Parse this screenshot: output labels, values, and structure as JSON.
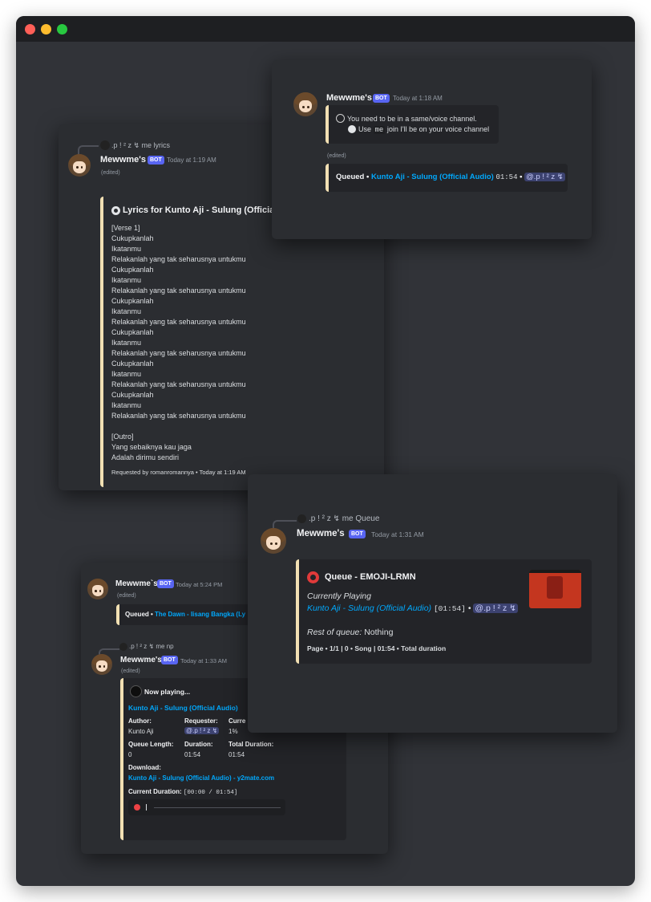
{
  "window": {
    "traffic_colors": [
      "#ff5f57",
      "#febc2e",
      "#28c840"
    ]
  },
  "bot": {
    "name": "Mewwme's",
    "name_plain": "Mewwme`s",
    "badge": "BOT"
  },
  "voice_error": {
    "time": "Today at 1:18 AM",
    "line1": "You need to be in a same/voice channel.",
    "line2_pre": "Use",
    "line2_code": "me",
    "line2_post": "join I'll be on your voice channel",
    "edited": "(edited)",
    "queued_label": "Queued •",
    "queued_track": "Kunto Aji - Sulung (Official Audio)",
    "queued_duration": "01:54",
    "queued_sep": "•",
    "queued_user": "@.p ! ² z ↯"
  },
  "lyrics_msg": {
    "reply_text": ".p ! ² z ↯  me lyrics",
    "time": "Today at 1:19 AM",
    "edited": "(edited)",
    "title": "Lyrics for Kunto Aji - Sulung (Official",
    "lines": [
      "[Verse 1]",
      "Cukupkanlah",
      "Ikatanmu",
      "Relakanlah yang tak seharusnya untukmu",
      "Cukupkanlah",
      "Ikatanmu",
      "Relakanlah yang tak seharusnya untukmu",
      "Cukupkanlah",
      "Ikatanmu",
      "Relakanlah yang tak seharusnya untukmu",
      "Cukupkanlah",
      "Ikatanmu",
      "Relakanlah yang tak seharusnya untukmu",
      "Cukupkanlah",
      "Ikatanmu",
      "Relakanlah yang tak seharusnya untukmu",
      "Cukupkanlah",
      "Ikatanmu",
      "Relakanlah yang tak seharusnya untukmu",
      "",
      "[Outro]",
      "Yang sebaiknya kau jaga",
      "Adalah dirimu sendiri"
    ],
    "footer": "Requested by romanromannya • Today at 1:19 AM"
  },
  "queue_msg": {
    "reply_text": ".p ! ² z ↯  me Queue",
    "time": "Today at 1:31 AM",
    "title": "Queue - EMOJI-LRMN",
    "currently_playing": "Currently Playing",
    "track": "Kunto Aji - Sulung (Official Audio)",
    "duration": "[01:54]",
    "sep": "•",
    "user": "@.p ! ² z ↯",
    "rest_label": "Rest of queue:",
    "rest_value": "Nothing",
    "footer": "Page • 1/1 | 0 • Song | 01:54 • Total duration"
  },
  "dawn_msg": {
    "time": "Today at 5:24 PM",
    "edited": "(edited)",
    "queued_label": "Queued •",
    "queued_track": "The Dawn - Iisang Bangka (Ly"
  },
  "np_msg": {
    "reply_text": ".p ! ² z ↯  me np",
    "time": "Today at 1:33 AM",
    "edited": "(edited)",
    "title": "Now playing...",
    "track": "Kunto Aji - Sulung (Official Audio)",
    "fields": {
      "author_label": "Author:",
      "author_value": "Kunto Aji",
      "requester_label": "Requester:",
      "requester_value": "@.p ! ² z ↯",
      "curr_label": "Curre",
      "curr_value": "1%",
      "qlen_label": "Queue Length:",
      "qlen_value": "0",
      "dur_label": "Duration:",
      "dur_value": "01:54",
      "total_label": "Total Duration:",
      "total_value": "01:54"
    },
    "download_label": "Download:",
    "download_link": "Kunto Aji - Sulung (Official Audio) - y2mate.com",
    "current_label": "Current Duration:",
    "current_value": "[00:00 / 01:54]"
  }
}
